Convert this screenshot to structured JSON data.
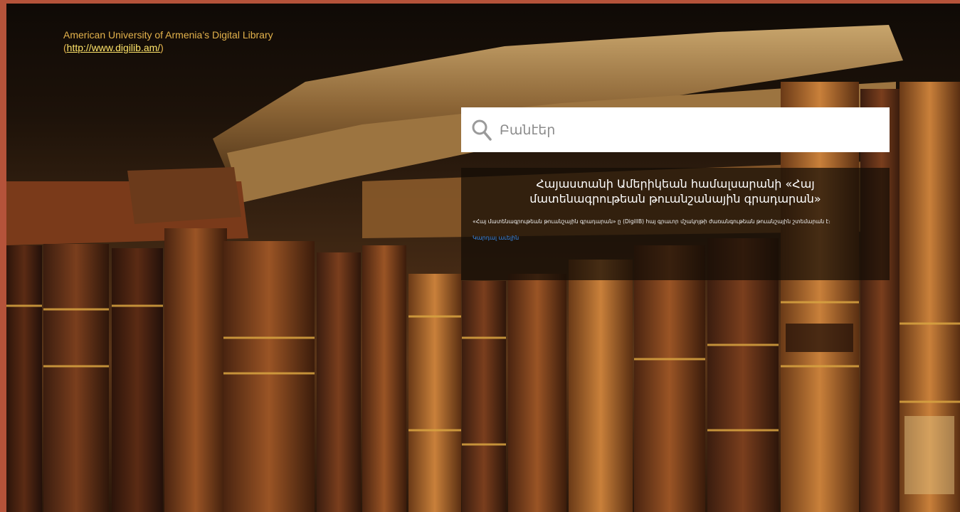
{
  "page": {
    "caption_line1": "American University of Armenia’s Digital Library",
    "caption_line2_prefix": "(",
    "caption_link": "http://www.digilib.am/",
    "caption_line2_suffix": ")"
  },
  "search": {
    "placeholder": "Բանէեր",
    "icon": "search-icon"
  },
  "info": {
    "title": "Հայաստանի Ամերիկեան համալսարանի «Հայ մատենագրութեան թուանշանային գրադարան»",
    "description": "«Հայ մատենագրութեան թուանշային գրադարան» ը (DigilIB) հայ գրաւոր մշակոյթի ժառանգութեան թուանշային շտեմարան է։",
    "link": "Կարդալ աւելին"
  },
  "colors": {
    "frame": "#b5533a",
    "caption": "#e3b24c",
    "caption_link": "#ffe46a",
    "link": "#3d8ff0"
  }
}
